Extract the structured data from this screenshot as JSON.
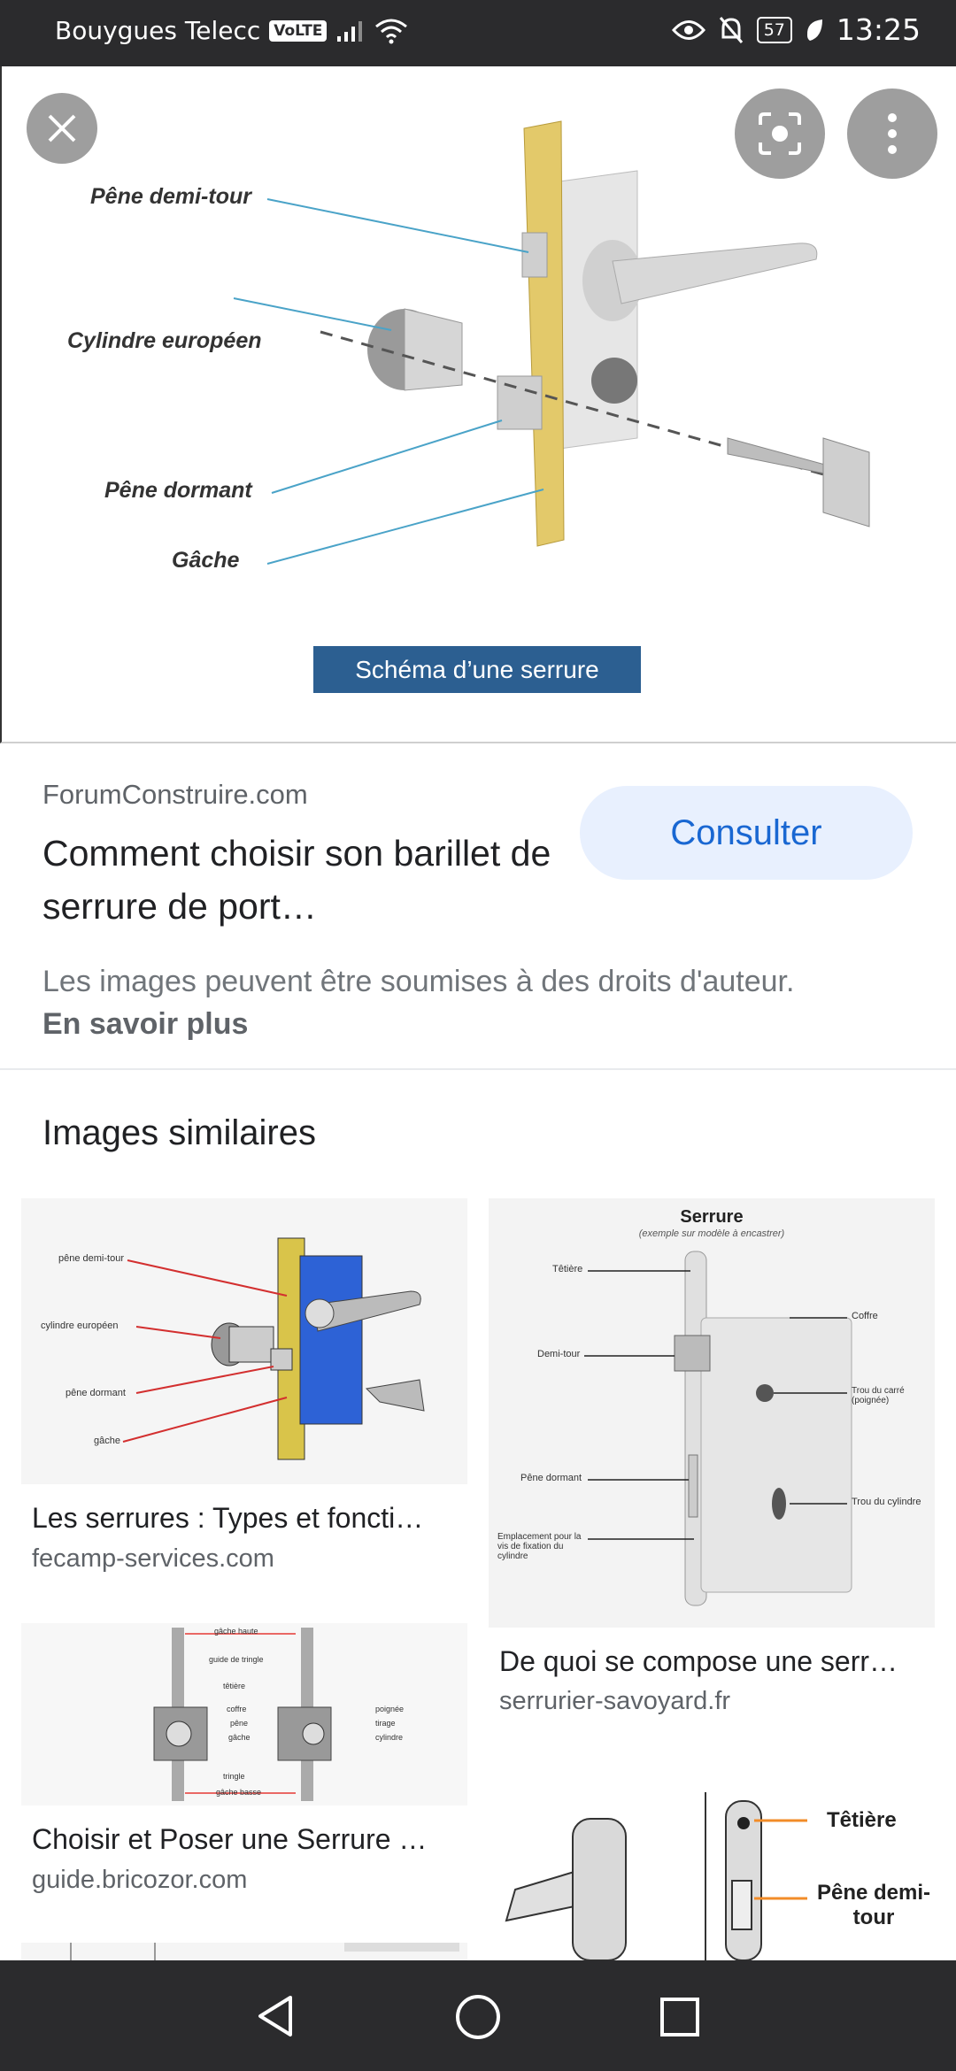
{
  "status": {
    "carrier": "Bouygues Telecc",
    "volte": "VoLTE",
    "battery": "57",
    "time": "13:25"
  },
  "hero": {
    "diagram_labels": {
      "pene_demi_tour": "Pêne demi-tour",
      "cylindre": "Cylindre européen",
      "pene_dormant": "Pêne dormant",
      "gache": "Gâche"
    },
    "caption": "Schéma d’une serrure"
  },
  "source": {
    "site": "ForumConstruire.com",
    "title": "Comment choisir son barillet de serrure de port…",
    "button": "Consulter",
    "rights_text": "Les images peuvent être soumises à des droits d'auteur.",
    "rights_link": "En savoir plus"
  },
  "similar": {
    "heading": "Images similaires",
    "items": [
      {
        "title": "Les serrures : Types et foncti…",
        "site": "fecamp-services.com",
        "labels": [
          "pêne demi-tour",
          "cylindre européen",
          "pêne dormant",
          "gâche"
        ]
      },
      {
        "title": "De quoi se compose une serr…",
        "site": "serrurier-savoyard.fr",
        "header": "Serrure",
        "subheader": "(exemple sur modèle à encastrer)",
        "labels": [
          "Têtière",
          "Demi-tour",
          "Pêne dormant",
          "Emplacement pour la vis de fixation du cylindre",
          "Coffre",
          "Trou du carré (poignée)",
          "Trou du cylindre"
        ]
      },
      {
        "title": "Choisir et Poser une Serrure …",
        "site": "guide.bricozor.com",
        "labels": [
          "gâche haute",
          "guide de tringle",
          "têtière",
          "coffre",
          "pêne",
          "gâche",
          "tringle",
          "gâche basse",
          "poignée",
          "tirage",
          "cylindre"
        ]
      },
      {
        "labels": [
          "Têtière",
          "Pêne demi-tour"
        ]
      }
    ]
  }
}
